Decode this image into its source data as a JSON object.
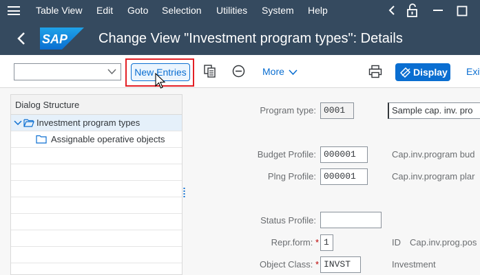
{
  "menubar": {
    "items": [
      "Table View",
      "Edit",
      "Goto",
      "Selection",
      "Utilities",
      "System",
      "Help"
    ]
  },
  "titlebar": {
    "title": "Change View \"Investment program types\": Details",
    "logo_text": "SAP"
  },
  "toolbar": {
    "command_field_value": "",
    "new_entries_label": "New Entries",
    "more_label": "More",
    "display_label": "Display",
    "exit_label": "Exit"
  },
  "dialog_structure": {
    "header": "Dialog Structure",
    "items": [
      {
        "label": "Investment program types",
        "level": 0,
        "selected": true,
        "expanded": true
      },
      {
        "label": "Assignable operative objects",
        "level": 1,
        "selected": false
      }
    ]
  },
  "form": {
    "program_type": {
      "label": "Program type:",
      "value": "0001",
      "description": "Sample cap. inv. pro"
    },
    "budget_profile": {
      "label": "Budget Profile:",
      "value": "000001",
      "description": "Cap.inv.program bud"
    },
    "plng_profile": {
      "label": "Plng Profile:",
      "value": "000001",
      "description": "Cap.inv.program plar"
    },
    "status_profile": {
      "label": "Status Profile:",
      "value": ""
    },
    "repr_form": {
      "label": "Repr.form:",
      "required": "*",
      "value": "1",
      "id_label": "ID",
      "description": "Cap.inv.prog.pos"
    },
    "object_class": {
      "label": "Object Class:",
      "required": "*",
      "value": "INVST",
      "description": "Investment"
    }
  },
  "colors": {
    "shell": "#354a5f",
    "accent": "#0a6ed1",
    "highlight": "#e31e24"
  }
}
